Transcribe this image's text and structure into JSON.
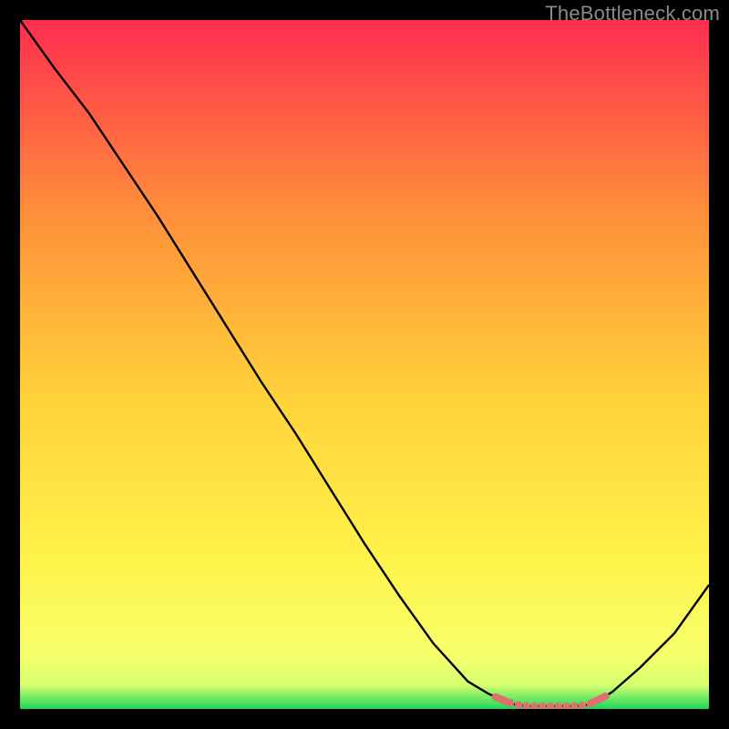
{
  "attribution": "TheBottleneck.com",
  "chart_data": {
    "type": "line",
    "title": "",
    "xlabel": "",
    "ylabel": "",
    "xlim": [
      0,
      100
    ],
    "ylim": [
      0,
      100
    ],
    "x": [
      0,
      5,
      10,
      15,
      20,
      25,
      30,
      35,
      40,
      45,
      50,
      55,
      60,
      65,
      68,
      70,
      72,
      74,
      76,
      78,
      80,
      82,
      84,
      86,
      90,
      95,
      100
    ],
    "values": [
      100,
      93,
      86.5,
      79,
      71.5,
      63.5,
      55.5,
      47.5,
      40,
      32,
      24,
      16.5,
      9.5,
      4,
      2.2,
      1.3,
      0.6,
      0.4,
      0.4,
      0.4,
      0.4,
      0.5,
      1.2,
      2.5,
      6,
      11,
      18
    ],
    "series_color": "#000000",
    "optimal_range": {
      "x0": 69,
      "x1": 85
    },
    "optimal_marker_color": "#e07070",
    "gradient_colors": {
      "top": "#ff2d4f",
      "mid_upper": "#ff8f3a",
      "mid": "#ffd23a",
      "mid_lower": "#fff24a",
      "near_bottom": "#f7ff6b",
      "bottom": "#1cd858"
    }
  }
}
